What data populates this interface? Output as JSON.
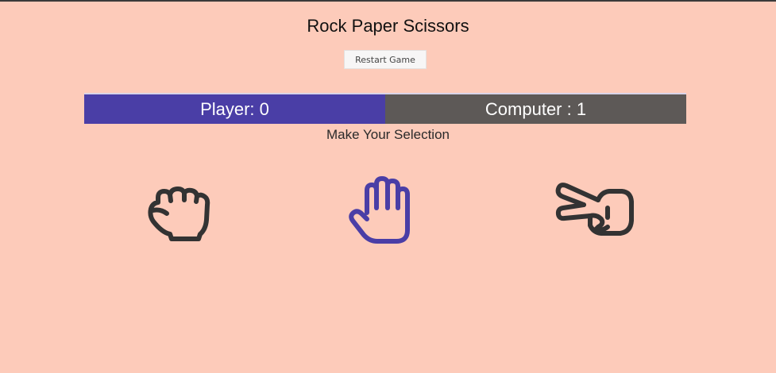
{
  "game": {
    "title": "Rock Paper Scissors",
    "restart_label": "Restart Game",
    "prompt": "Make Your Selection"
  },
  "scoreboard": {
    "player_text": "Player: 0",
    "computer_text": "Computer : 1",
    "player_color": "#4a3ea6",
    "computer_color": "#5d5957"
  },
  "choices": [
    {
      "icon": "fist-icon",
      "selected": false
    },
    {
      "icon": "open-hand-icon",
      "selected": true
    },
    {
      "icon": "scissors-hand-icon",
      "selected": false
    }
  ],
  "colors": {
    "background": "#fdcbba",
    "icon_default": "#333333",
    "icon_selected": "#4a3ea6"
  }
}
